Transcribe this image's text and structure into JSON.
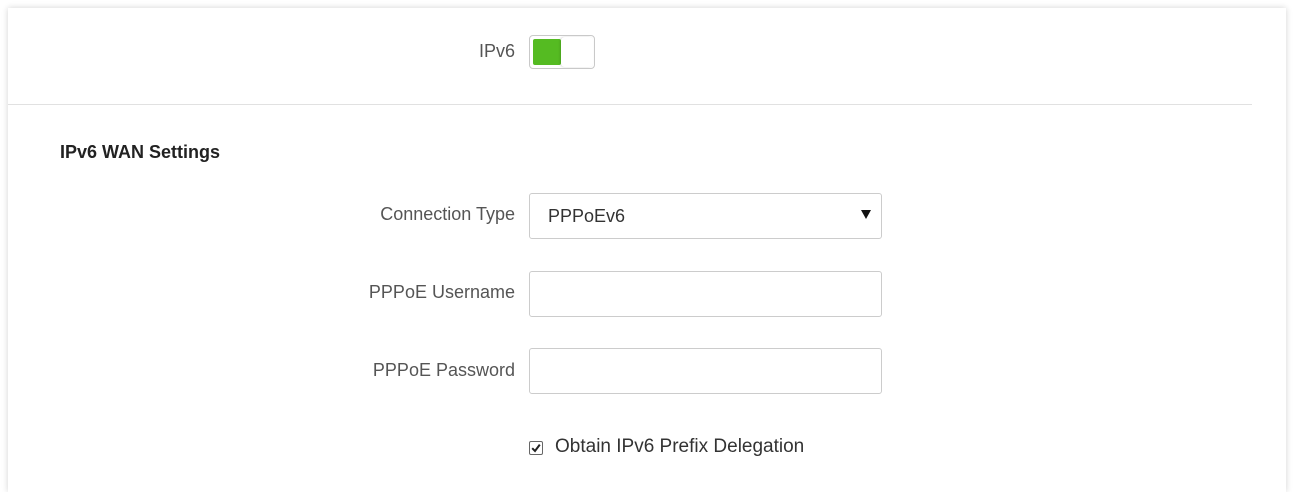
{
  "ipv6": {
    "label": "IPv6",
    "enabled": true,
    "toggle_color": "#55bb22"
  },
  "wan": {
    "section_title": "IPv6 WAN Settings",
    "connection_type": {
      "label": "Connection Type",
      "value": "PPPoEv6"
    },
    "username": {
      "label": "PPPoE Username",
      "value": ""
    },
    "password": {
      "label": "PPPoE Password",
      "value": ""
    },
    "prefix_delegation": {
      "label": "Obtain IPv6 Prefix Delegation",
      "checked": true
    }
  }
}
